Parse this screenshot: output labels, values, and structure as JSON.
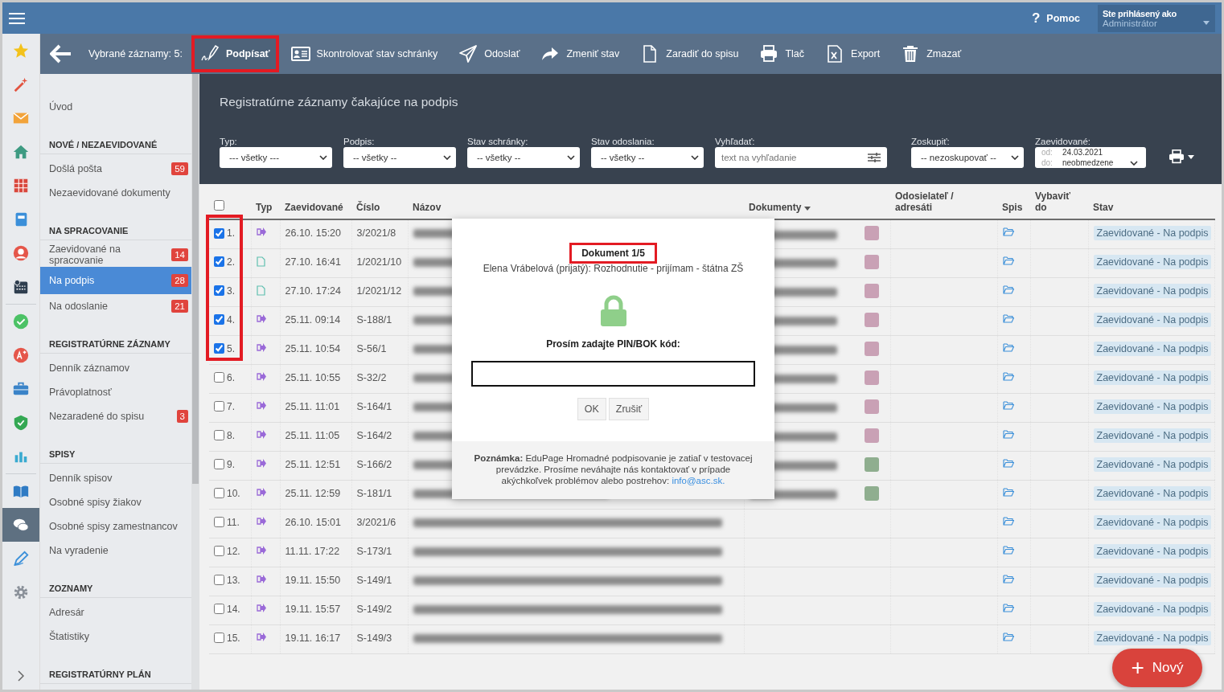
{
  "top_bar": {
    "help": "?",
    "help_label": "Pomoc",
    "user_caption": "Ste prihlásený ako",
    "user_name": "Administrátor"
  },
  "rail": [
    {
      "kind": "star",
      "selected": false
    },
    {
      "kind": "wand",
      "selected": false
    },
    {
      "kind": "mail",
      "selected": false
    },
    {
      "kind": "house",
      "selected": false
    },
    {
      "kind": "grid",
      "selected": false
    },
    {
      "kind": "notebook",
      "selected": false
    },
    {
      "kind": "person",
      "selected": false
    },
    {
      "kind": "calendar",
      "selected": false
    },
    {
      "kind": "divider"
    },
    {
      "kind": "check",
      "selected": false
    },
    {
      "kind": "grade",
      "selected": false
    },
    {
      "kind": "briefcase",
      "selected": false
    },
    {
      "kind": "shield",
      "selected": false
    },
    {
      "kind": "chart",
      "selected": false
    },
    {
      "kind": "divider"
    },
    {
      "kind": "book",
      "selected": false
    },
    {
      "kind": "chat",
      "selected": true
    },
    {
      "kind": "pen",
      "selected": false
    },
    {
      "kind": "gear",
      "selected": false
    }
  ],
  "toolbar": {
    "selection": "Vybrané záznamy: 5:",
    "buttons": [
      {
        "kind": "sign",
        "label": "Podpísať",
        "highlighted": true
      },
      {
        "kind": "idcard",
        "label": "Skontrolovať stav schránky",
        "highlighted": false
      },
      {
        "kind": "send",
        "label": "Odoslať",
        "highlighted": false
      },
      {
        "kind": "share",
        "label": "Zmeniť stav",
        "highlighted": false
      },
      {
        "kind": "file",
        "label": "Zaradiť do spisu",
        "highlighted": false
      },
      {
        "kind": "print",
        "label": "Tlač",
        "highlighted": false
      },
      {
        "kind": "excel",
        "label": "Export",
        "highlighted": false
      },
      {
        "kind": "trash",
        "label": "Zmazať",
        "highlighted": false
      }
    ]
  },
  "sidebar": {
    "items": [
      {
        "label": "Úvod",
        "selected": false
      }
    ],
    "sections": [
      {
        "title": "NOVÉ / NEZAEVIDOVANÉ",
        "items": [
          {
            "label": "Došlá pošta",
            "badge": "59",
            "selected": false
          },
          {
            "label": "Nezaevidované dokumenty",
            "selected": false
          }
        ]
      },
      {
        "title": "NA SPRACOVANIE",
        "items": [
          {
            "label": "Zaevidované na spracovanie",
            "badge": "14",
            "selected": false
          },
          {
            "label": "Na podpis",
            "badge": "28",
            "selected": true
          },
          {
            "label": "Na odoslanie",
            "badge": "21",
            "selected": false
          }
        ]
      },
      {
        "title": "REGISTRATÚRNE ZÁZNAMY",
        "items": [
          {
            "label": "Denník záznamov",
            "selected": false
          },
          {
            "label": "Právoplatnosť",
            "selected": false
          },
          {
            "label": "Nezaradené do spisu",
            "badge": "3",
            "selected": false
          }
        ]
      },
      {
        "title": "SPISY",
        "items": [
          {
            "label": "Denník spisov",
            "selected": false
          },
          {
            "label": "Osobné spisy žiakov",
            "selected": false
          },
          {
            "label": "Osobné spisy zamestnancov",
            "selected": false
          },
          {
            "label": "Na vyradenie",
            "selected": false
          }
        ]
      },
      {
        "title": "ZOZNAMY",
        "items": [
          {
            "label": "Adresár",
            "selected": false
          },
          {
            "label": "Štatistiky",
            "selected": false
          }
        ]
      },
      {
        "title": "REGISTRATÚRNY PLÁN"
      }
    ]
  },
  "page": {
    "subtitle": "Registratúrne záznamy čakajúce na podpis"
  },
  "filters": [
    {
      "kind": "select",
      "label": "Typ:",
      "value": "--- všetky ---"
    },
    {
      "kind": "select",
      "label": "Podpis:",
      "value": "-- všetky --"
    },
    {
      "kind": "select",
      "label": "Stav schránky:",
      "value": "-- všetky --"
    },
    {
      "kind": "select",
      "label": "Stav odoslania:",
      "value": "-- všetky --"
    },
    {
      "kind": "search",
      "label": "Vyhľadať:",
      "placeholder": "text na vyhľadanie"
    },
    {
      "kind": "select",
      "label": "Zoskupiť:",
      "value": "-- nezoskupovať --"
    },
    {
      "kind": "daterange",
      "label": "Zaevidované:",
      "from_label": "od:",
      "from": "24.03.2021",
      "to_label": "do:",
      "to": "neobmedzene"
    }
  ],
  "table": {
    "select_all_checked": false,
    "columns": [
      "Typ",
      "Zaevidované",
      "Číslo",
      "Názov",
      "Dokumenty",
      "Odosielateľ / adresáti",
      "Spis",
      "Vybaviť do",
      "Stav"
    ],
    "rows": [
      {
        "number": "1.",
        "checked": true,
        "highlighted": true,
        "kind": "outgoing",
        "date": "26.10. 15:20",
        "ref": "3/2021/8",
        "doc": {
          "color": "#c9a1b5"
        },
        "status": "Zaevidované - Na podpis"
      },
      {
        "number": "2.",
        "checked": true,
        "highlighted": true,
        "kind": "document",
        "date": "27.10. 16:41",
        "ref": "1/2021/10",
        "doc": {
          "color": "#c9a1b5"
        },
        "status": "Zaevidované - Na podpis"
      },
      {
        "number": "3.",
        "checked": true,
        "highlighted": true,
        "kind": "document",
        "date": "27.10. 17:24",
        "ref": "1/2021/12",
        "doc": {
          "color": "#c9a1b5"
        },
        "status": "Zaevidované - Na podpis"
      },
      {
        "number": "4.",
        "checked": true,
        "highlighted": true,
        "kind": "outgoing",
        "date": "25.11. 09:14",
        "ref": "S-188/1",
        "doc": {
          "color": "#c9a1b5"
        },
        "status": "Zaevidované - Na podpis"
      },
      {
        "number": "5.",
        "checked": true,
        "highlighted": true,
        "kind": "outgoing",
        "date": "25.11. 10:54",
        "ref": "S-56/1",
        "doc": {
          "color": "#c9a1b5"
        },
        "status": "Zaevidované - Na podpis"
      },
      {
        "number": "6.",
        "checked": false,
        "highlighted": false,
        "kind": "outgoing",
        "date": "25.11. 10:55",
        "ref": "S-32/2",
        "doc": {
          "color": "#c9a1b5"
        },
        "status": "Zaevidované - Na podpis"
      },
      {
        "number": "7.",
        "checked": false,
        "highlighted": false,
        "kind": "outgoing",
        "date": "25.11. 11:01",
        "ref": "S-164/1",
        "doc": {
          "color": "#c9a1b5"
        },
        "status": "Zaevidované - Na podpis"
      },
      {
        "number": "8.",
        "checked": false,
        "highlighted": false,
        "kind": "outgoing",
        "date": "25.11. 11:05",
        "ref": "S-164/2",
        "doc": {
          "color": "#c9a1b5"
        },
        "status": "Zaevidované - Na podpis"
      },
      {
        "number": "9.",
        "checked": false,
        "highlighted": false,
        "kind": "outgoing",
        "date": "25.11. 12:51",
        "ref": "S-166/2",
        "doc": {
          "color": "#8fae8f"
        },
        "status": "Zaevidované - Na podpis"
      },
      {
        "number": "10.",
        "checked": false,
        "highlighted": false,
        "kind": "outgoing",
        "date": "25.11. 12:59",
        "ref": "S-181/1",
        "doc": {
          "color": "#8fae8f"
        },
        "status": "Zaevidované - Na podpis"
      },
      {
        "number": "11.",
        "checked": false,
        "highlighted": false,
        "kind": "outgoing",
        "date": "26.10. 15:01",
        "ref": "3/2021/6",
        "status": "Zaevidované - Na podpis"
      },
      {
        "number": "12.",
        "checked": false,
        "highlighted": false,
        "kind": "outgoing",
        "date": "11.11. 17:22",
        "ref": "S-173/1",
        "status": "Zaevidované - Na podpis"
      },
      {
        "number": "13.",
        "checked": false,
        "highlighted": false,
        "kind": "outgoing",
        "date": "19.11. 15:50",
        "ref": "S-149/1",
        "status": "Zaevidované - Na podpis"
      },
      {
        "number": "14.",
        "checked": false,
        "highlighted": false,
        "kind": "outgoing",
        "date": "19.11. 15:57",
        "ref": "S-149/2",
        "status": "Zaevidované - Na podpis"
      },
      {
        "number": "15.",
        "checked": false,
        "highlighted": false,
        "kind": "outgoing",
        "date": "19.11. 16:17",
        "ref": "S-149/3",
        "status": "Zaevidované - Na podpis"
      }
    ]
  },
  "dialog": {
    "title": "Dokument 1/5",
    "title_highlighted": true,
    "subtitle": "Elena Vrábelová (prijatý): Rozhodnutie - prijímam - štátna ZŠ",
    "prompt": "Prosím zadajte PIN/BOK kód:",
    "buttons": [
      "OK",
      "Zrušiť"
    ],
    "note": "**Poznámka:** EduPage Hromadné podpisovanie je zatiaľ v testovacej prevádzke. Prosíme neváhajte nás kontaktovať v prípade akýchkoľvek problémov alebo postrehov:",
    "note_link": "info@asc.sk."
  },
  "fab": {
    "icon": "+",
    "label": "Nový"
  }
}
